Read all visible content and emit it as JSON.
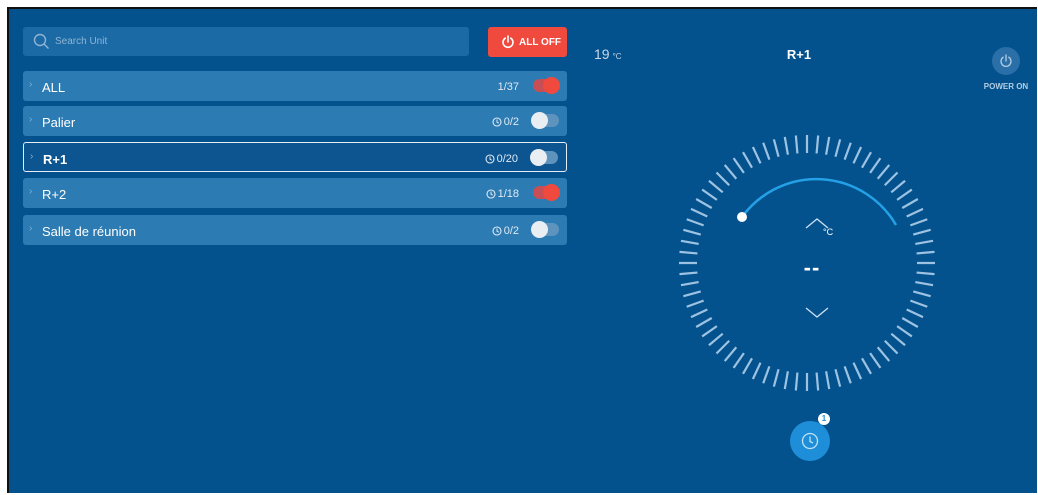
{
  "search": {
    "placeholder": "Search Unit"
  },
  "all_off": {
    "label": "ALL OFF"
  },
  "groups": [
    {
      "name": "ALL",
      "count": "1/37",
      "show_clock": false,
      "on": true
    },
    {
      "name": "Palier",
      "count": "0/2",
      "show_clock": true,
      "on": false
    },
    {
      "name": "R+1",
      "count": "0/20",
      "show_clock": true,
      "on": false,
      "selected": true
    },
    {
      "name": "R+2",
      "count": "1/18",
      "show_clock": true,
      "on": true
    },
    {
      "name": "Salle de réunion",
      "count": "0/2",
      "show_clock": true,
      "on": false
    }
  ],
  "panel": {
    "room_temp": "19",
    "room_temp_unit": "°C",
    "title": "R+1",
    "power_label": "POWER ON",
    "set_unit": "°C",
    "set_value": "--",
    "schedule_badge": "1"
  },
  "colors": {
    "background": "#03528e",
    "row": "#2c7bb3",
    "accent_red": "#f04a3e",
    "accent_blue": "#1f8ed9"
  }
}
